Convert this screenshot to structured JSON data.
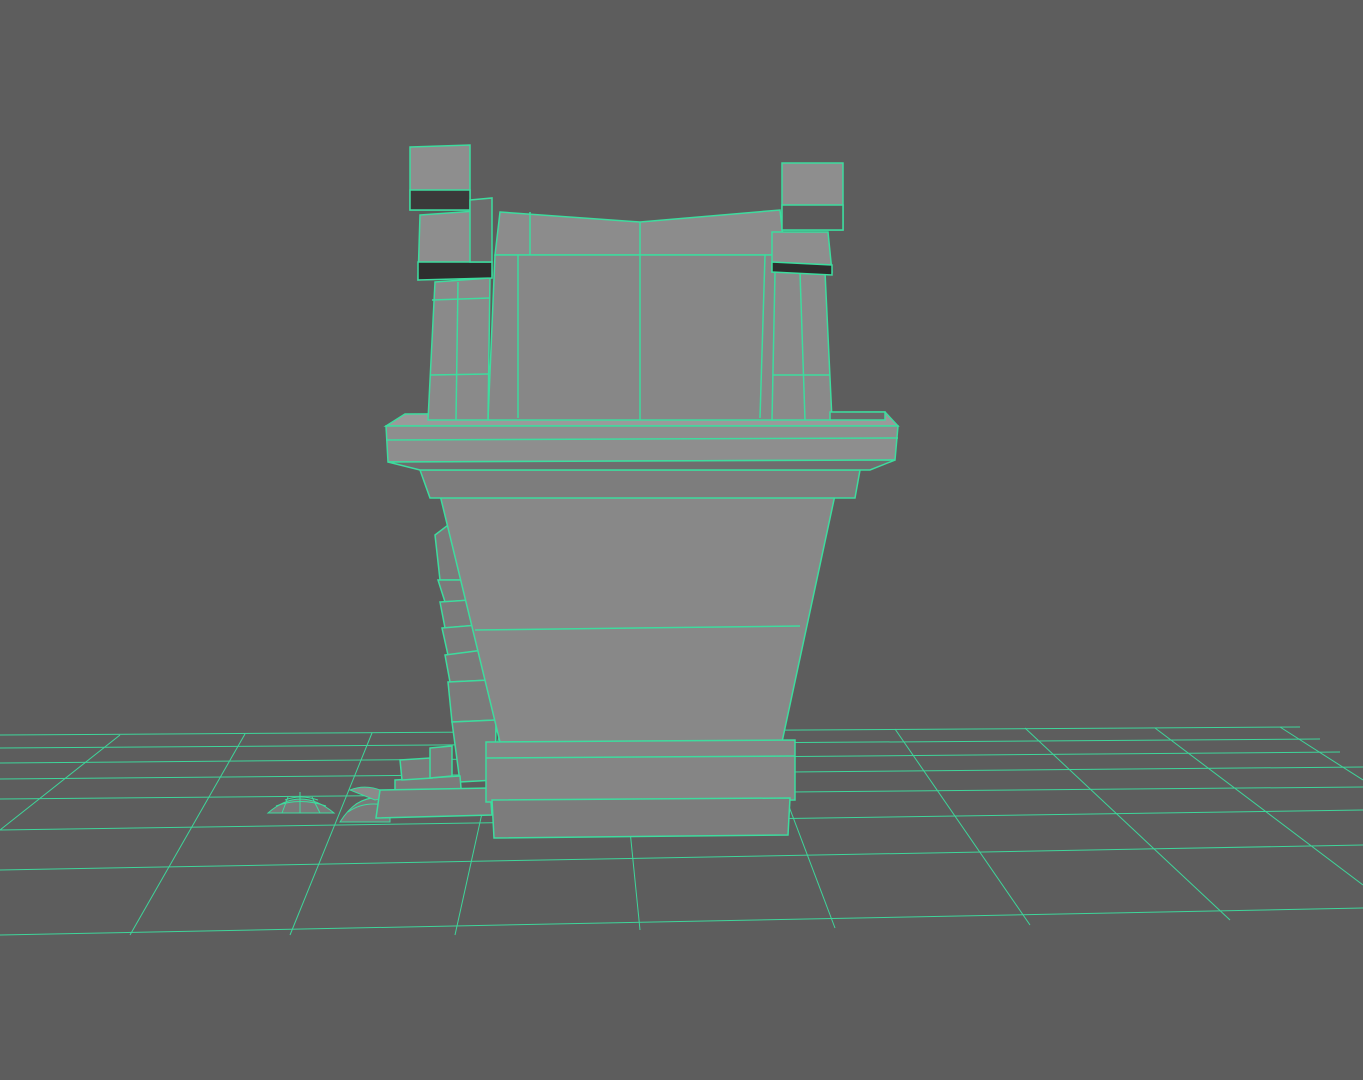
{
  "viewport": {
    "view": "3d-perspective",
    "background_color": "#5d5d5d",
    "wireframe_color": "#3ddc9e",
    "face_color": "#868686",
    "ground_grid": true
  },
  "scene_objects": [
    {
      "name": "building-body"
    },
    {
      "name": "roof-ledge"
    },
    {
      "name": "upper-section"
    },
    {
      "name": "left-pillar"
    },
    {
      "name": "right-pillar"
    },
    {
      "name": "base-plinth"
    },
    {
      "name": "side-staircase"
    },
    {
      "name": "small-dome-left"
    },
    {
      "name": "small-dome-right"
    }
  ]
}
